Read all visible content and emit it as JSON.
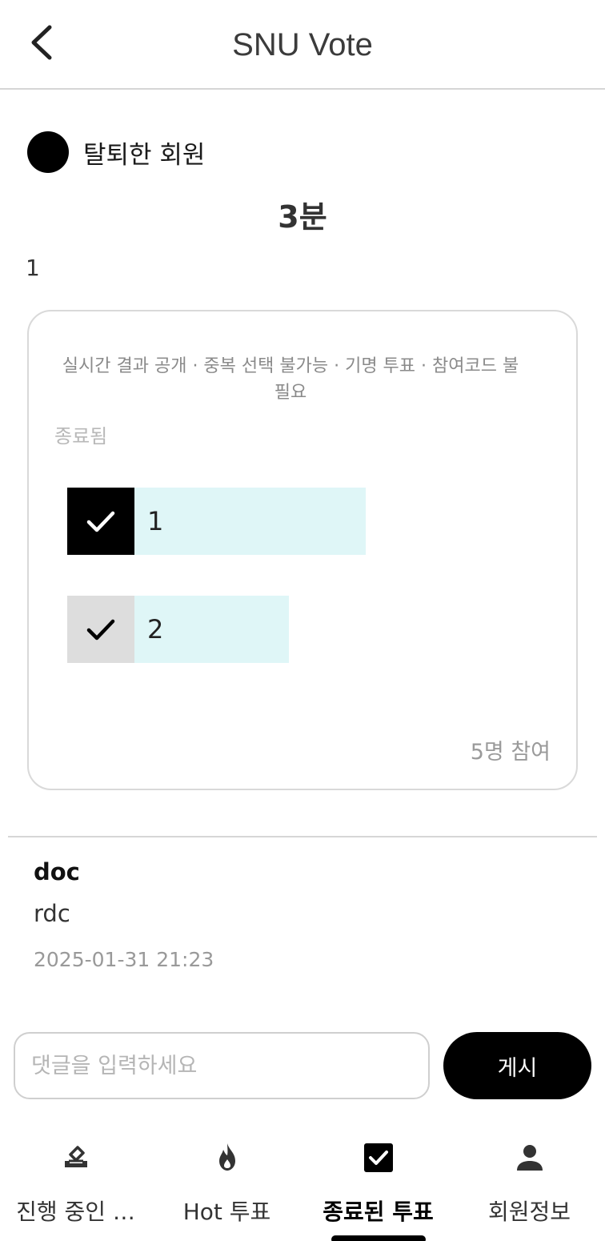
{
  "header": {
    "title": "SNU Vote",
    "back_icon": "chevron-left-icon"
  },
  "poll": {
    "author": "탈퇴한 회원",
    "title": "3분",
    "description": "1",
    "settings": "실시간 결과 공개 · 중복 선택 불가능 · 기명 투표 · 참여코드 불필요",
    "status": "종료됨",
    "options": [
      {
        "label": "1",
        "selected": true,
        "share": 0.6
      },
      {
        "label": "2",
        "selected": false,
        "share": 0.4
      }
    ],
    "participants": "5명 참여"
  },
  "comments": [
    {
      "author": "doc",
      "text": "rdc",
      "time": "2025-01-31 21:23"
    }
  ],
  "comment_form": {
    "placeholder": "댓글을 입력하세요",
    "submit_label": "게시"
  },
  "tabs": [
    {
      "label": "진행 중인 …",
      "icon": "ballot-box-icon",
      "active": false
    },
    {
      "label": "Hot 투표",
      "icon": "flame-icon",
      "active": false
    },
    {
      "label": "종료된 투표",
      "icon": "checkbox-icon",
      "active": true
    },
    {
      "label": "회원정보",
      "icon": "person-icon",
      "active": false
    }
  ]
}
